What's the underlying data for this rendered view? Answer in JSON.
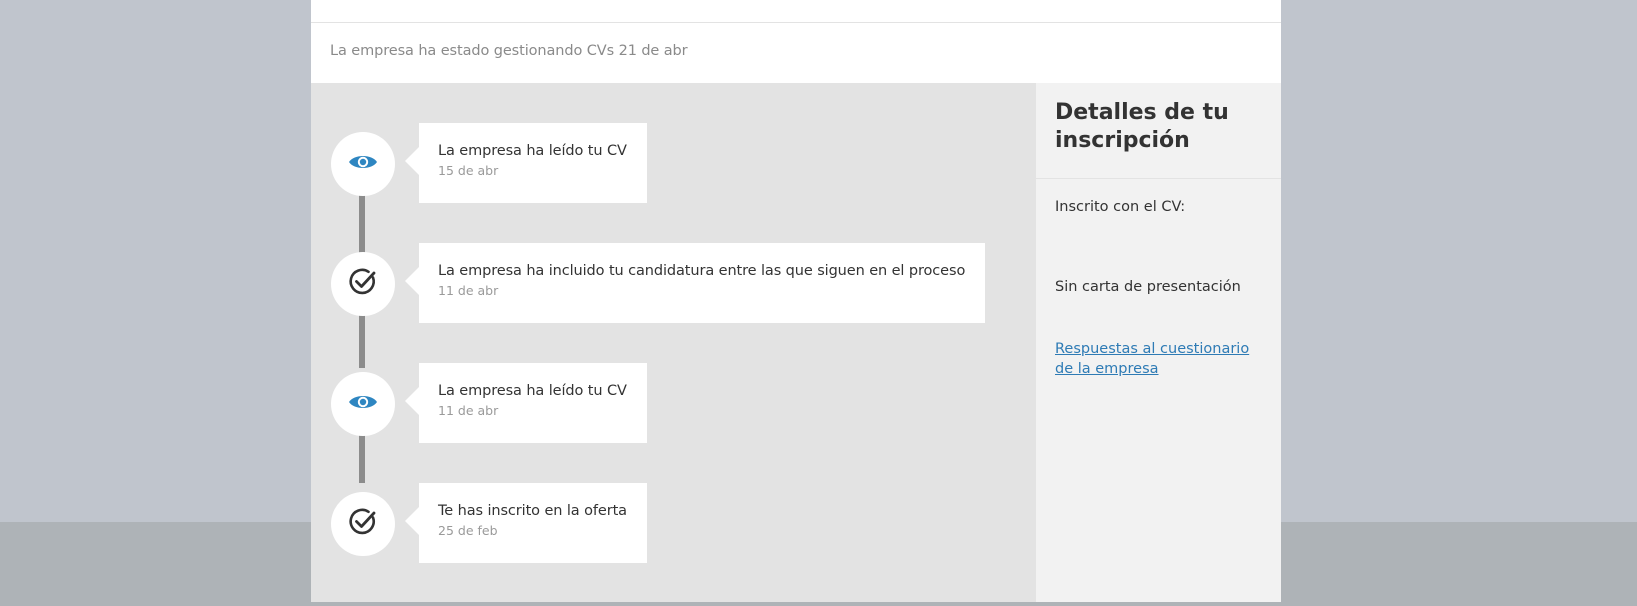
{
  "status": {
    "text": "La empresa ha estado gestionando CVs 21 de abr"
  },
  "timeline": {
    "events": [
      {
        "icon": "eye-icon",
        "title": "La empresa ha leído tu CV",
        "date": "15 de abr"
      },
      {
        "icon": "check-circle-icon",
        "title": "La empresa ha incluido tu candidatura entre las que siguen en el proceso",
        "date": "11 de abr"
      },
      {
        "icon": "eye-icon",
        "title": "La empresa ha leído tu CV",
        "date": "11 de abr"
      },
      {
        "icon": "check-circle-icon",
        "title": "Te has inscrito en la oferta",
        "date": "25 de feb"
      }
    ]
  },
  "details": {
    "title": "Detalles de tu inscripción",
    "cv_label": "Inscrito con el CV:",
    "cover_letter": "Sin carta de presentación",
    "questionnaire_link": "Respuestas al cuestionario de la empresa"
  },
  "colors": {
    "eye_icon": "#2e86c1",
    "check_icon": "#333333",
    "link": "#2e7bb5",
    "timeline_bg": "#e3e3e3",
    "details_bg": "#f2f2f2",
    "page_bg": "#c0c5cd"
  }
}
